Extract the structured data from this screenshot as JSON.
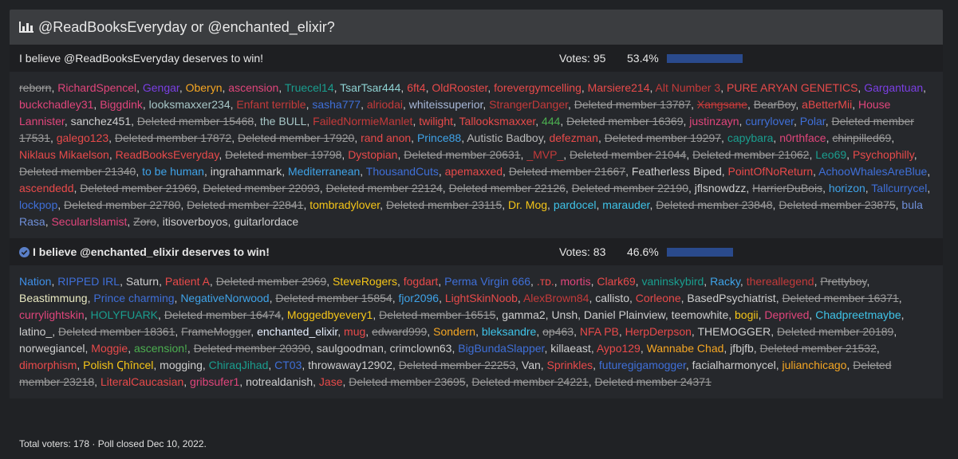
{
  "poll": {
    "title": "@ReadBooksEveryday or @enchanted_elixir?",
    "title_icon": "bar-chart-icon",
    "options": [
      {
        "label": "I believe @ReadBooksEveryday deserves to win!",
        "votes_text": "Votes: 95",
        "percent_text": "53.4%",
        "fill": 0.534,
        "voters": [
          {
            "n": "reborn",
            "c": "#9a9a9a",
            "d": true
          },
          {
            "n": "RichardSpencel",
            "c": "#e0457b"
          },
          {
            "n": "Gengar",
            "c": "#7b3fe4"
          },
          {
            "n": "Oberyn",
            "c": "#f5a623"
          },
          {
            "n": "ascension",
            "c": "#e0457b"
          },
          {
            "n": "Truecel14",
            "c": "#1a9e8f"
          },
          {
            "n": "TsarTsar444",
            "c": "#8fd3d3"
          },
          {
            "n": "6ft4",
            "c": "#e84a4a"
          },
          {
            "n": "OldRooster",
            "c": "#e84a4a"
          },
          {
            "n": "forevergymcelling",
            "c": "#e84a4a"
          },
          {
            "n": "Marsiere214",
            "c": "#e84a4a"
          },
          {
            "n": "Alt Number 3",
            "c": "#c43a3a"
          },
          {
            "n": "PURE ARYAN GENETICS",
            "c": "#e84a4a"
          },
          {
            "n": "Gargantuan",
            "c": "#7b3fe4"
          },
          {
            "n": "buckchadley31",
            "c": "#e0457b"
          },
          {
            "n": "Biggdink",
            "c": "#e0457b"
          },
          {
            "n": "looksmaxxer234",
            "c": "#a8c8c8"
          },
          {
            "n": "Enfant terrible",
            "c": "#c43a3a"
          },
          {
            "n": "sasha777",
            "c": "#3f6fd8"
          },
          {
            "n": "alriodai",
            "c": "#c43a3a"
          },
          {
            "n": "whiteissuperior",
            "c": "#a8b8d8"
          },
          {
            "n": "StrangerDanger",
            "c": "#c43a3a"
          },
          {
            "n": "Deleted member 13787",
            "c": "#9a9a9a",
            "d": true
          },
          {
            "n": "Xangsane",
            "c": "#c43a3a",
            "d": true
          },
          {
            "n": "BearBoy",
            "c": "#9a9a9a",
            "d": true
          },
          {
            "n": "aBetterMii",
            "c": "#e84a4a"
          },
          {
            "n": "House Lannister",
            "c": "#e0457b"
          },
          {
            "n": "sanchez451",
            "c": "#cfcfcf"
          },
          {
            "n": "Deleted member 15468",
            "c": "#9a9a9a",
            "d": true
          },
          {
            "n": "the BULL",
            "c": "#a8c8c8"
          },
          {
            "n": "FailedNormieManlet",
            "c": "#c43a3a"
          },
          {
            "n": "twilight",
            "c": "#e84a4a"
          },
          {
            "n": "Tallooksmaxxer",
            "c": "#e84a4a"
          },
          {
            "n": "444",
            "c": "#4caf50"
          },
          {
            "n": "Deleted member 16369",
            "c": "#9a9a9a",
            "d": true
          },
          {
            "n": "justinzayn",
            "c": "#e0457b"
          },
          {
            "n": "currylover",
            "c": "#3f6fd8"
          },
          {
            "n": "Polar",
            "c": "#3f6fd8"
          },
          {
            "n": "Deleted member 17531",
            "c": "#9a9a9a",
            "d": true
          },
          {
            "n": "galego123",
            "c": "#e84a4a"
          },
          {
            "n": "Deleted member 17872",
            "c": "#9a9a9a",
            "d": true
          },
          {
            "n": "Deleted member 17920",
            "c": "#9a9a9a",
            "d": true
          },
          {
            "n": "rand anon",
            "c": "#e84a4a"
          },
          {
            "n": "Prince88",
            "c": "#3fa3e8"
          },
          {
            "n": "Autistic Badboy",
            "c": "#b8b8b8"
          },
          {
            "n": "defezman",
            "c": "#e84a4a"
          },
          {
            "n": "Deleted member 19297",
            "c": "#9a9a9a",
            "d": true
          },
          {
            "n": "capybara",
            "c": "#1a9e8f"
          },
          {
            "n": "n0rthface",
            "c": "#e0457b"
          },
          {
            "n": "chinpilled69",
            "c": "#9a9a9a",
            "d": true
          },
          {
            "n": "Niklaus Mikaelson",
            "c": "#e84a4a"
          },
          {
            "n": "ReadBooksEveryday",
            "c": "#e84a4a"
          },
          {
            "n": "Deleted member 19798",
            "c": "#9a9a9a",
            "d": true
          },
          {
            "n": "Dystopian",
            "c": "#e84a4a"
          },
          {
            "n": "Deleted member 20631",
            "c": "#9a9a9a",
            "d": true
          },
          {
            "n": "_MVP_",
            "c": "#c43a3a"
          },
          {
            "n": "Deleted member 21044",
            "c": "#9a9a9a",
            "d": true
          },
          {
            "n": "Deleted member 21062",
            "c": "#9a9a9a",
            "d": true
          },
          {
            "n": "Leo69",
            "c": "#1a9e8f"
          },
          {
            "n": "Psychophilly",
            "c": "#e84a4a"
          },
          {
            "n": "Deleted member 21340",
            "c": "#9a9a9a",
            "d": true
          },
          {
            "n": "to be human",
            "c": "#3fa3e8"
          },
          {
            "n": "ingrahammark",
            "c": "#cfcfcf"
          },
          {
            "n": "Mediterranean",
            "c": "#3fa3e8"
          },
          {
            "n": "ThousandCuts",
            "c": "#3f6fd8"
          },
          {
            "n": "apemaxxed",
            "c": "#e84a4a"
          },
          {
            "n": "Deleted member 21667",
            "c": "#9a9a9a",
            "d": true
          },
          {
            "n": "Featherless Biped",
            "c": "#cfcfcf"
          },
          {
            "n": "PointOfNoReturn",
            "c": "#e84a4a"
          },
          {
            "n": "AchooWhalesAreBlue",
            "c": "#3f6fd8"
          },
          {
            "n": "ascendedd",
            "c": "#e84a4a"
          },
          {
            "n": "Deleted member 21969",
            "c": "#9a9a9a",
            "d": true
          },
          {
            "n": "Deleted member 22093",
            "c": "#9a9a9a",
            "d": true
          },
          {
            "n": "Deleted member 22124",
            "c": "#9a9a9a",
            "d": true
          },
          {
            "n": "Deleted member 22126",
            "c": "#9a9a9a",
            "d": true
          },
          {
            "n": "Deleted member 22190",
            "c": "#9a9a9a",
            "d": true
          },
          {
            "n": "jflsnowdzz",
            "c": "#cfcfcf"
          },
          {
            "n": "HarrierDuBois",
            "c": "#9a9a9a",
            "d": true
          },
          {
            "n": "horizon",
            "c": "#3fa3e8"
          },
          {
            "n": "Tallcurrycel",
            "c": "#3f6fd8"
          },
          {
            "n": "lockpop",
            "c": "#3f6fd8"
          },
          {
            "n": "Deleted member 22780",
            "c": "#9a9a9a",
            "d": true
          },
          {
            "n": "Deleted member 22841",
            "c": "#9a9a9a",
            "d": true
          },
          {
            "n": "tombradylover",
            "c": "#f5c518"
          },
          {
            "n": "Deleted member 23115",
            "c": "#9a9a9a",
            "d": true
          },
          {
            "n": "Dr. Mog",
            "c": "#f5c518"
          },
          {
            "n": "pardocel",
            "c": "#3fc3e8"
          },
          {
            "n": "marauder",
            "c": "#3fc3e8"
          },
          {
            "n": "Deleted member 23848",
            "c": "#9a9a9a",
            "d": true
          },
          {
            "n": "Deleted member 23875",
            "c": "#9a9a9a",
            "d": true
          },
          {
            "n": "bula Rasa",
            "c": "#6f8fd8"
          },
          {
            "n": "SecularIslamist",
            "c": "#e0457b"
          },
          {
            "n": "Zoro",
            "c": "#9a9a9a",
            "d": true
          },
          {
            "n": "itisoverboyos",
            "c": "#cfcfcf"
          },
          {
            "n": "guitarlordace",
            "c": "#cfcfcf"
          }
        ]
      },
      {
        "label": "I believe @enchanted_elixir deserves to win!",
        "check_icon": "check-circle-icon",
        "votes_text": "Votes: 83",
        "percent_text": "46.6%",
        "fill": 0.466,
        "voters": [
          {
            "n": "Nation",
            "c": "#3f8fe8"
          },
          {
            "n": "RIPPED IRL",
            "c": "#3f6fd8"
          },
          {
            "n": "Saturn",
            "c": "#cfcfcf"
          },
          {
            "n": "Patient A",
            "c": "#e84a4a"
          },
          {
            "n": "Deleted member 2969",
            "c": "#9a9a9a",
            "d": true
          },
          {
            "n": "SteveRogers",
            "c": "#f5c518"
          },
          {
            "n": "fogdart",
            "c": "#e84a4a"
          },
          {
            "n": "Perma Virgin 666",
            "c": "#3f6fd8"
          },
          {
            "n": ".тᴅ.",
            "c": "#e84a4a"
          },
          {
            "n": "mortis",
            "c": "#e0457b"
          },
          {
            "n": "Clark69",
            "c": "#e84a4a"
          },
          {
            "n": "vaninskybird",
            "c": "#1a9e8f"
          },
          {
            "n": "Racky",
            "c": "#3fa3e8"
          },
          {
            "n": "thereallegend",
            "c": "#c43a3a"
          },
          {
            "n": "Prettyboy",
            "c": "#9a9a9a",
            "d": true
          },
          {
            "n": "Beastimmung",
            "c": "#e8e8c0"
          },
          {
            "n": "Prince charming",
            "c": "#3f6fd8"
          },
          {
            "n": "NegativeNorwood",
            "c": "#3fa3e8"
          },
          {
            "n": "Deleted member 15854",
            "c": "#9a9a9a",
            "d": true
          },
          {
            "n": "fjor2096",
            "c": "#3fa3e8"
          },
          {
            "n": "LightSkinNoob",
            "c": "#e84a4a"
          },
          {
            "n": "AlexBrown84",
            "c": "#c43a3a"
          },
          {
            "n": "callisto",
            "c": "#cfcfcf"
          },
          {
            "n": "Corleone",
            "c": "#e84a4a"
          },
          {
            "n": "BasedPsychiatrist",
            "c": "#cfcfcf"
          },
          {
            "n": "Deleted member 16371",
            "c": "#9a9a9a",
            "d": true
          },
          {
            "n": "currylightskin",
            "c": "#e0457b"
          },
          {
            "n": "HOLYFUARK",
            "c": "#1a9e8f"
          },
          {
            "n": "Deleted member 16474",
            "c": "#9a9a9a",
            "d": true
          },
          {
            "n": "Moggedbyevery1",
            "c": "#f5c518"
          },
          {
            "n": "Deleted member 16515",
            "c": "#9a9a9a",
            "d": true
          },
          {
            "n": "gamma2",
            "c": "#cfcfcf"
          },
          {
            "n": "Unsh",
            "c": "#cfcfcf"
          },
          {
            "n": "Daniel Plainview",
            "c": "#cfcfcf"
          },
          {
            "n": "teemowhite",
            "c": "#cfcfcf"
          },
          {
            "n": "bogii",
            "c": "#f5c518"
          },
          {
            "n": "Deprived",
            "c": "#e0457b"
          },
          {
            "n": "Chadpreetmaybe",
            "c": "#3fc3e8"
          },
          {
            "n": "latino_",
            "c": "#cfcfcf"
          },
          {
            "n": "Deleted member 18361",
            "c": "#9a9a9a",
            "d": true
          },
          {
            "n": "FrameMogger",
            "c": "#9a9a9a",
            "d": true
          },
          {
            "n": "enchanted_elixir",
            "c": "#e8f0ff"
          },
          {
            "n": "mug",
            "c": "#e84a4a"
          },
          {
            "n": "edward999",
            "c": "#9a9a9a",
            "d": true
          },
          {
            "n": "Sondern",
            "c": "#f5a623"
          },
          {
            "n": "bleksandre",
            "c": "#3fc3e8"
          },
          {
            "n": "op463",
            "c": "#9a9a9a",
            "d": true
          },
          {
            "n": "NFA PB",
            "c": "#e84a4a"
          },
          {
            "n": "HerpDerpson",
            "c": "#e84a4a"
          },
          {
            "n": "THEMOGGER",
            "c": "#cfcfcf"
          },
          {
            "n": "Deleted member 20189",
            "c": "#9a9a9a",
            "d": true
          },
          {
            "n": "norwegiancel",
            "c": "#cfcfcf"
          },
          {
            "n": "Moggie",
            "c": "#e84a4a"
          },
          {
            "n": "ascension!",
            "c": "#4caf50"
          },
          {
            "n": "Deleted member 20390",
            "c": "#9a9a9a",
            "d": true
          },
          {
            "n": "saulgoodman",
            "c": "#cfcfcf"
          },
          {
            "n": "crimclown63",
            "c": "#cfcfcf"
          },
          {
            "n": "BigBundaSlapper",
            "c": "#3f6fd8"
          },
          {
            "n": "killaeast",
            "c": "#cfcfcf"
          },
          {
            "n": "Aypo129",
            "c": "#e84a4a"
          },
          {
            "n": "Wannabe Chad",
            "c": "#f5a623"
          },
          {
            "n": "jfbjfb",
            "c": "#cfcfcf"
          },
          {
            "n": "Deleted member 21532",
            "c": "#9a9a9a",
            "d": true
          },
          {
            "n": "dimorphism",
            "c": "#e84a4a"
          },
          {
            "n": "Polish Ꞔhîncel",
            "c": "#f5c518"
          },
          {
            "n": "mogging",
            "c": "#cfcfcf"
          },
          {
            "n": "ChiraqJihad",
            "c": "#1a9e8f"
          },
          {
            "n": "CT03",
            "c": "#3f6fd8"
          },
          {
            "n": "throwaway12902",
            "c": "#cfcfcf"
          },
          {
            "n": "Deleted member 22253",
            "c": "#9a9a9a",
            "d": true
          },
          {
            "n": "Van",
            "c": "#cfcfcf"
          },
          {
            "n": "Sprinkles",
            "c": "#e84a4a"
          },
          {
            "n": "futuregigamogger",
            "c": "#3f6fd8"
          },
          {
            "n": "facialharmonycel",
            "c": "#cfcfcf"
          },
          {
            "n": "julianchicago",
            "c": "#f5a623"
          },
          {
            "n": "Deleted member 23218",
            "c": "#9a9a9a",
            "d": true
          },
          {
            "n": "LiteralCaucasian",
            "c": "#e84a4a"
          },
          {
            "n": "gribsufer1",
            "c": "#e0457b"
          },
          {
            "n": "notrealdanish",
            "c": "#cfcfcf"
          },
          {
            "n": "Jase",
            "c": "#e84a4a"
          },
          {
            "n": "Deleted member 23695",
            "c": "#9a9a9a",
            "d": true
          },
          {
            "n": "Deleted member 24221",
            "c": "#9a9a9a",
            "d": true
          },
          {
            "n": "Deleted member 24371",
            "c": "#9a9a9a",
            "d": true
          }
        ]
      }
    ],
    "footer": "Total voters: 178 · Poll closed Dec 10, 2022."
  },
  "colors": {
    "background": "#202225",
    "header": "#3b3d40",
    "bar": "#2a4a8c"
  }
}
